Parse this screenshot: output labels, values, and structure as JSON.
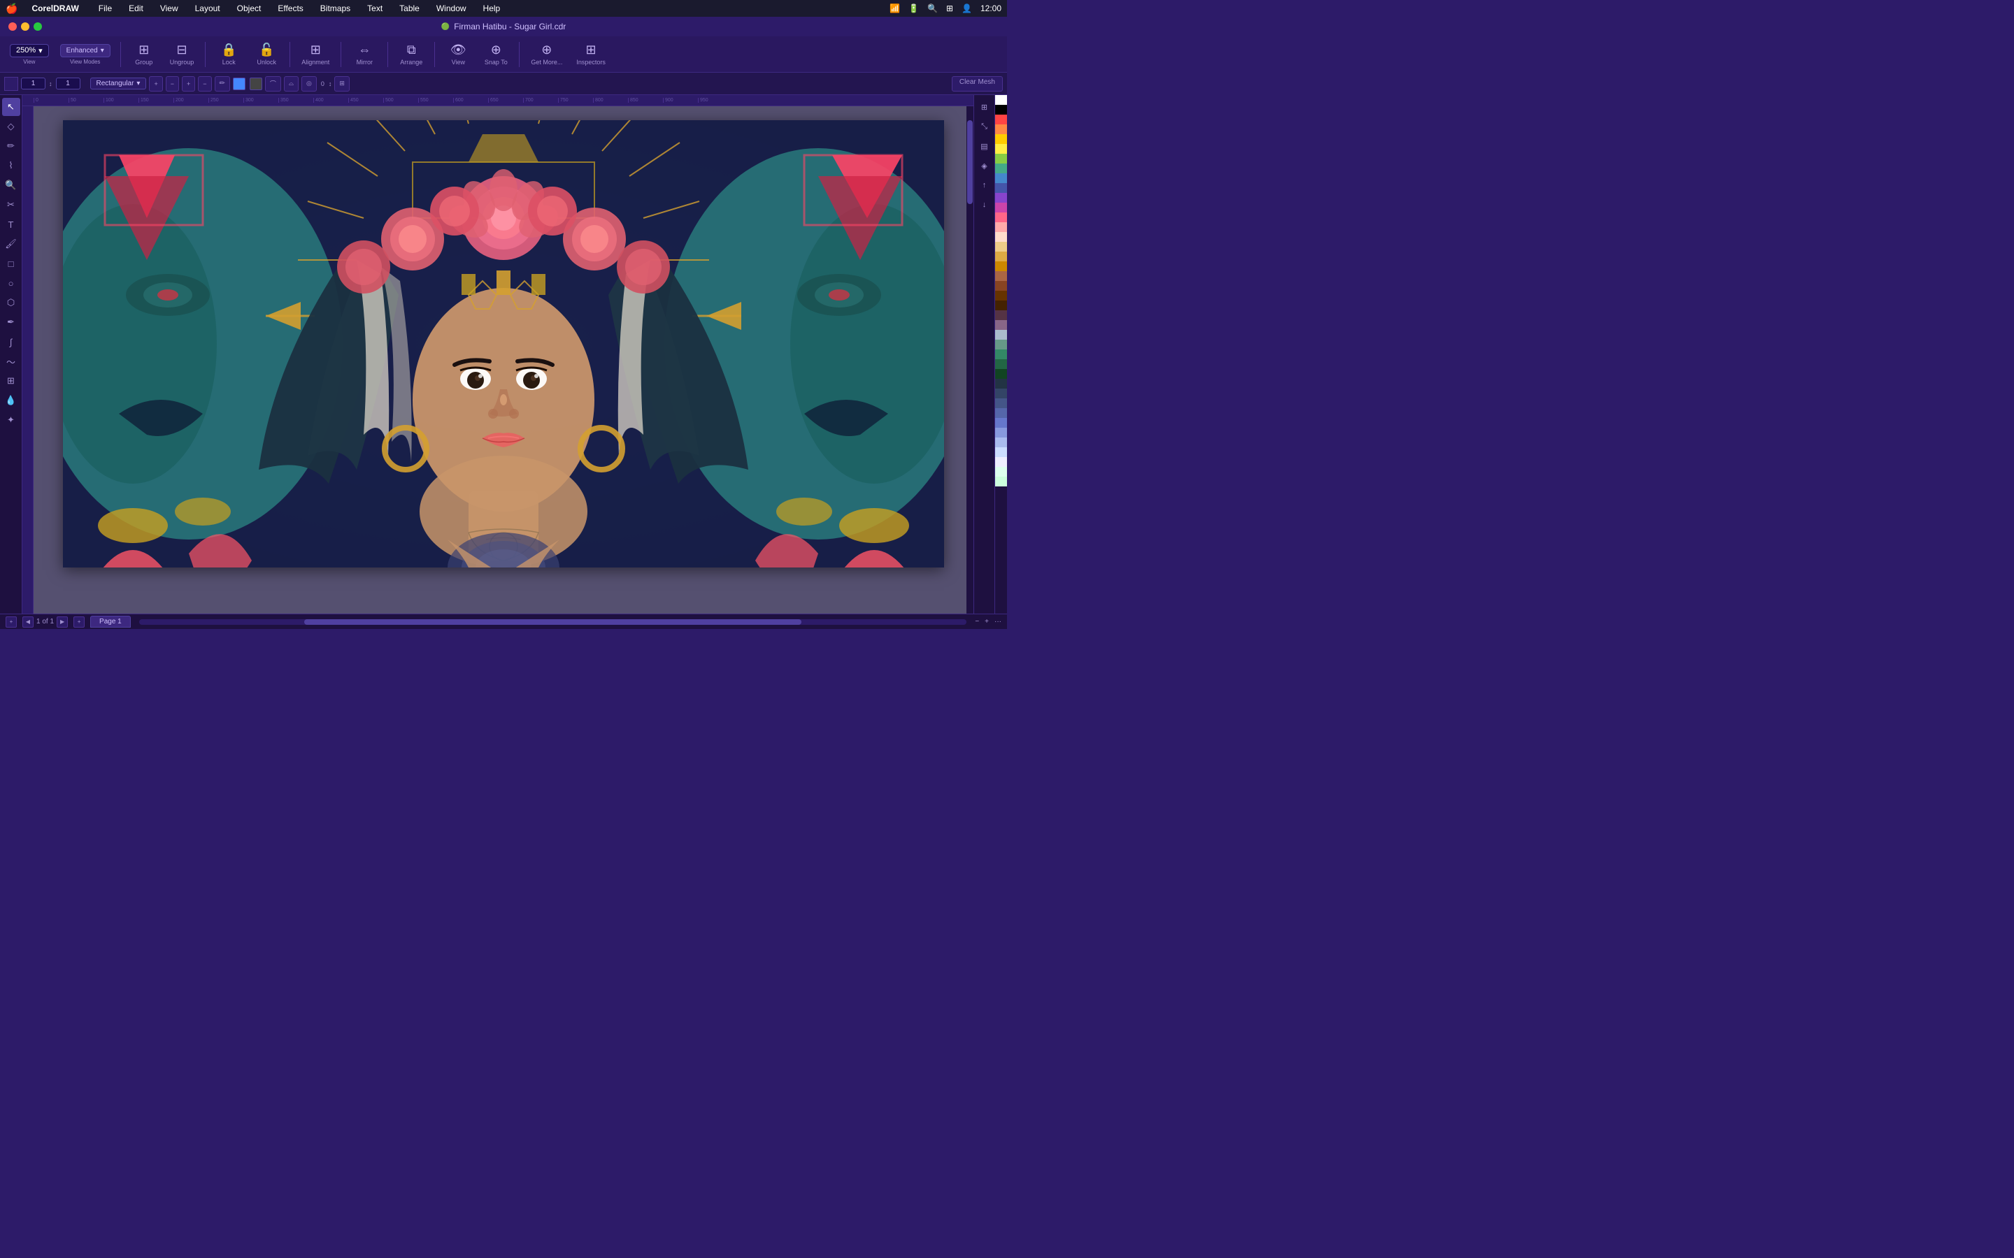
{
  "app": {
    "name": "CorelDRAW",
    "title": "Firman Hatibu -  Sugar Girl.cdr"
  },
  "menubar": {
    "apple": "🍎",
    "app_name": "CorelDRAW",
    "items": [
      "File",
      "Edit",
      "View",
      "Layout",
      "Object",
      "Effects",
      "Bitmaps",
      "Text",
      "Table",
      "Window",
      "Help"
    ]
  },
  "titlebar": {
    "title": "Firman Hatibu -  Sugar Girl.cdr",
    "icon": "🟢"
  },
  "toolbar": {
    "zoom_value": "250%",
    "view_mode": "Enhanced",
    "group_label": "Group",
    "ungroup_label": "Ungroup",
    "lock_label": "Lock",
    "unlock_label": "Unlock",
    "alignment_label": "Alignment",
    "mirror_label": "Mirror",
    "arrange_label": "Arrange",
    "view_label": "View",
    "snap_to_label": "Snap To",
    "get_more_label": "Get More...",
    "inspectors_label": "Inspectors"
  },
  "secondary_toolbar": {
    "shape_type": "Rectangular",
    "number_value": "0",
    "clear_mesh_label": "Clear Mesh"
  },
  "status_bar": {
    "page_info": "1 of 1",
    "page_label": "Page 1"
  },
  "palette_colors": [
    "#ffffff",
    "#000000",
    "#ff4444",
    "#ff8844",
    "#ffcc00",
    "#ffee44",
    "#88cc44",
    "#44aa88",
    "#4488cc",
    "#4455aa",
    "#8844cc",
    "#cc44aa",
    "#ff6688",
    "#ffaaaa",
    "#ffddcc",
    "#eecc88",
    "#ddaa44",
    "#cc8800",
    "#aa6644",
    "#884422",
    "#663300",
    "#442200",
    "#553344",
    "#886688",
    "#aabbcc",
    "#669988",
    "#338866",
    "#226644",
    "#114422",
    "#223344",
    "#334466",
    "#445588",
    "#5566aa",
    "#6677cc",
    "#8899dd",
    "#aabbee",
    "#ccddff",
    "#eeeeff",
    "#ddffee",
    "#ccffdd"
  ],
  "right_panel_tools": [
    {
      "name": "properties-icon",
      "symbol": "⚙"
    },
    {
      "name": "transform-icon",
      "symbol": "⤡"
    },
    {
      "name": "layers-icon",
      "symbol": "▤"
    },
    {
      "name": "bookmark-icon",
      "symbol": "🔖"
    },
    {
      "name": "upload-icon",
      "symbol": "↑"
    },
    {
      "name": "download-icon",
      "symbol": "↓"
    }
  ],
  "left_tools": [
    {
      "name": "select-tool",
      "symbol": "↖",
      "active": true
    },
    {
      "name": "node-tool",
      "symbol": "◇"
    },
    {
      "name": "freehand-tool",
      "symbol": "✏"
    },
    {
      "name": "smart-draw-tool",
      "symbol": "⌇"
    },
    {
      "name": "zoom-tool",
      "symbol": "🔍"
    },
    {
      "name": "text-tool",
      "symbol": "T"
    },
    {
      "name": "paint-tool",
      "symbol": "🖌"
    },
    {
      "name": "fill-tool",
      "symbol": "▣"
    },
    {
      "name": "rectangle-tool",
      "symbol": "□"
    },
    {
      "name": "ellipse-tool",
      "symbol": "○"
    },
    {
      "name": "polygon-tool",
      "symbol": "⬡"
    },
    {
      "name": "pen-tool",
      "symbol": "✒"
    },
    {
      "name": "calligraphy-tool",
      "symbol": "∫"
    },
    {
      "name": "smear-tool",
      "symbol": "~"
    },
    {
      "name": "mesh-fill-tool",
      "symbol": "⊞"
    },
    {
      "name": "eyedropper-tool",
      "symbol": "💧"
    },
    {
      "name": "interactive-tool",
      "symbol": "✦"
    }
  ]
}
